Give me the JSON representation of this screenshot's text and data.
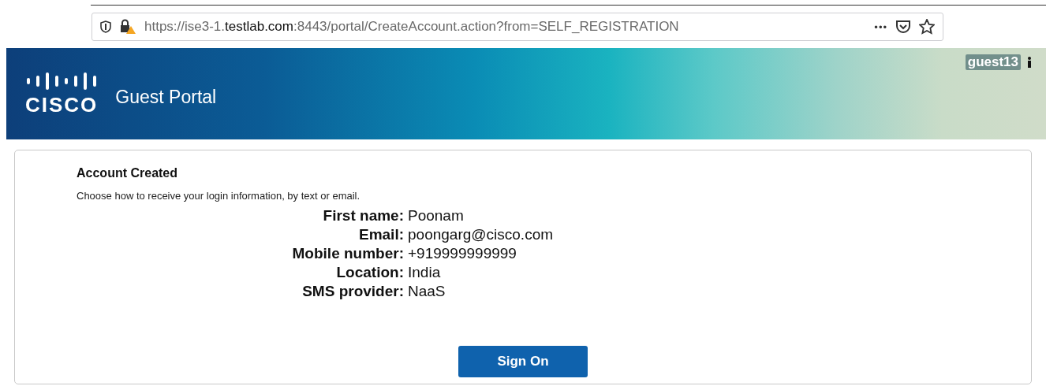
{
  "browser": {
    "url": "https://ise3-1.**testlab.com**:8443/portal/CreateAccount.action?from=SELF_REGISTRATION",
    "more": "•••"
  },
  "header": {
    "logo_text": "CISCO",
    "title": "Guest Portal",
    "user": "guest13"
  },
  "card": {
    "title": "Account Created",
    "message": "Choose how to receive your login information, by text or email.",
    "fields": [
      {
        "label": "First name:",
        "value": "Poonam"
      },
      {
        "label": "Email:",
        "value": "poongarg@cisco.com"
      },
      {
        "label": "Mobile number:",
        "value": "+919999999999"
      },
      {
        "label": "Location:",
        "value": "India"
      },
      {
        "label": "SMS provider:",
        "value": "NaaS"
      }
    ],
    "button": "Sign On"
  }
}
